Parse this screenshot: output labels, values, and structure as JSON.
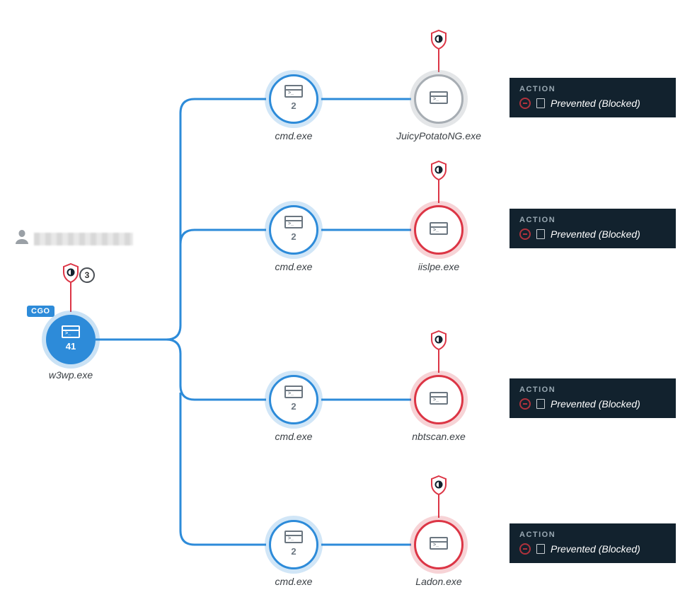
{
  "root": {
    "label": "w3wp.exe",
    "count": "41",
    "badge_count": "3",
    "cgo_tag": "CGO"
  },
  "branches": [
    {
      "mid_label": "cmd.exe",
      "mid_count": "2",
      "leaf_label": "JuicyPotatoNG.exe",
      "leaf_color": "gray"
    },
    {
      "mid_label": "cmd.exe",
      "mid_count": "2",
      "leaf_label": "iislpe.exe",
      "leaf_color": "red"
    },
    {
      "mid_label": "cmd.exe",
      "mid_count": "2",
      "leaf_label": "nbtscan.exe",
      "leaf_color": "red"
    },
    {
      "mid_label": "cmd.exe",
      "mid_count": "2",
      "leaf_label": "Ladon.exe",
      "leaf_color": "red"
    }
  ],
  "action": {
    "header": "ACTION",
    "status": "Prevented (Blocked)"
  }
}
